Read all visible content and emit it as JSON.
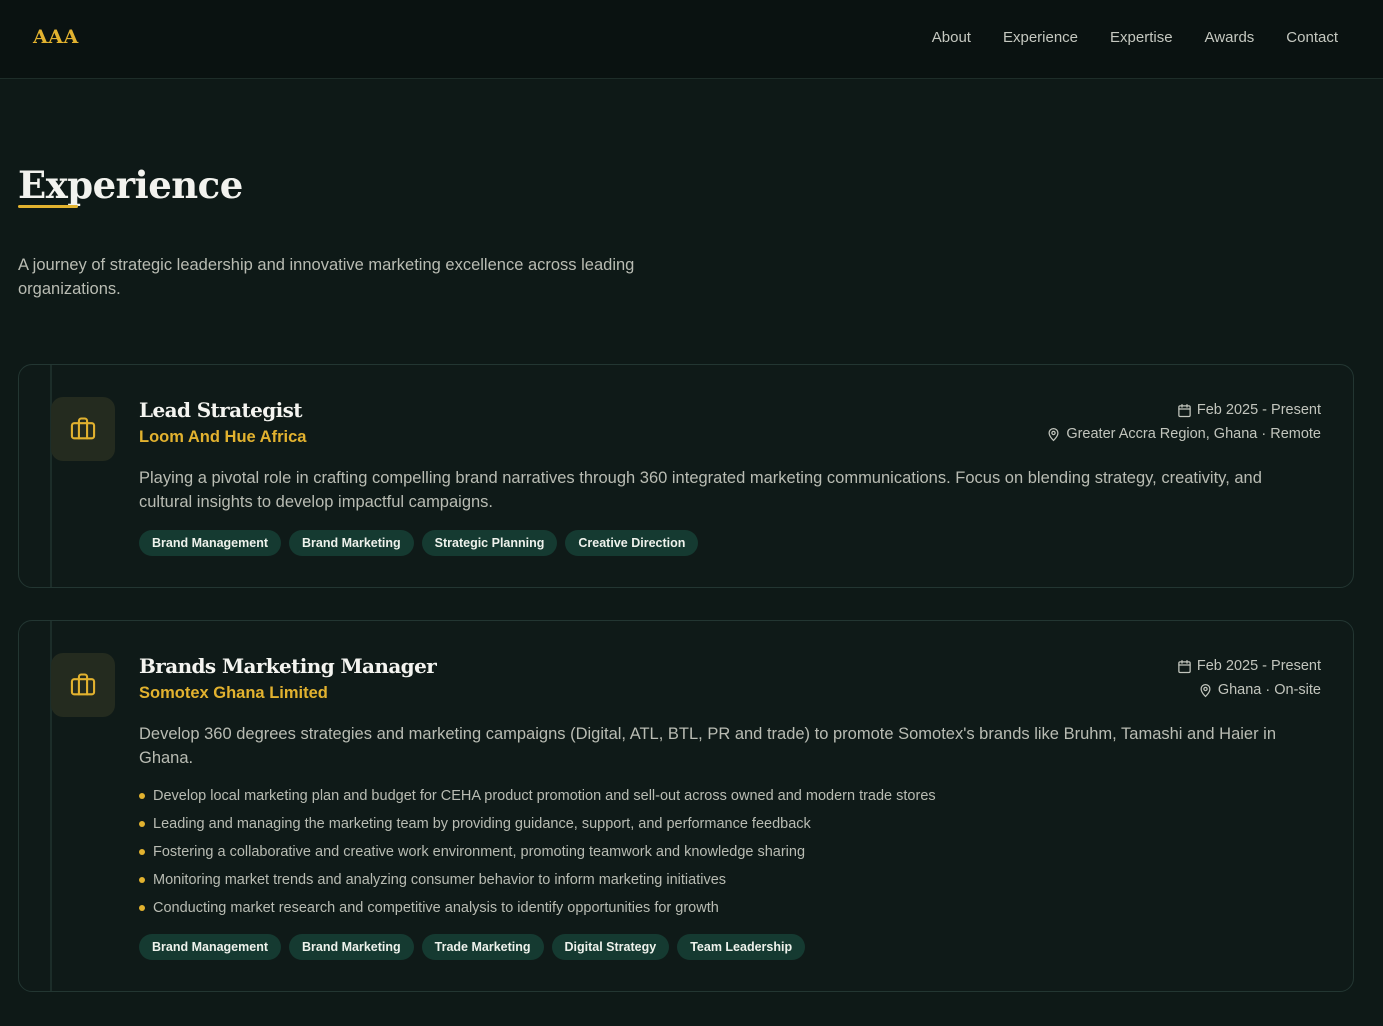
{
  "header": {
    "logo": "AAA",
    "nav": [
      "About",
      "Experience",
      "Expertise",
      "Awards",
      "Contact"
    ]
  },
  "section": {
    "title": "Experience",
    "intro": "A journey of strategic leadership and innovative marketing excellence across leading organizations."
  },
  "jobs": [
    {
      "role": "Lead Strategist",
      "company": "Loom And Hue Africa",
      "dates": "Feb 2025 - Present",
      "location": "Greater Accra Region, Ghana · Remote",
      "description": "Playing a pivotal role in crafting compelling brand narratives through 360 integrated marketing communications. Focus on blending strategy, creativity, and cultural insights to develop impactful campaigns.",
      "bullets": [],
      "tags": [
        "Brand Management",
        "Brand Marketing",
        "Strategic Planning",
        "Creative Direction"
      ]
    },
    {
      "role": "Brands Marketing Manager",
      "company": "Somotex Ghana Limited",
      "dates": "Feb 2025 - Present",
      "location": "Ghana · On-site",
      "description": "Develop 360 degrees strategies and marketing campaigns (Digital, ATL, BTL, PR and trade) to promote Somotex's brands like Bruhm, Tamashi and Haier in Ghana.",
      "bullets": [
        "Develop local marketing plan and budget for CEHA product promotion and sell-out across owned and modern trade stores",
        "Leading and managing the marketing team by providing guidance, support, and performance feedback",
        "Fostering a collaborative and creative work environment, promoting teamwork and knowledge sharing",
        "Monitoring market trends and analyzing consumer behavior to inform marketing initiatives",
        "Conducting market research and competitive analysis to identify opportunities for growth"
      ],
      "tags": [
        "Brand Management",
        "Brand Marketing",
        "Trade Marketing",
        "Digital Strategy",
        "Team Leadership"
      ]
    }
  ],
  "colors": {
    "accent": "#e2b22f",
    "background": "#0e1917",
    "tag_background": "#153a31"
  },
  "icons": [
    "briefcase-icon",
    "calendar-icon",
    "map-pin-icon"
  ]
}
